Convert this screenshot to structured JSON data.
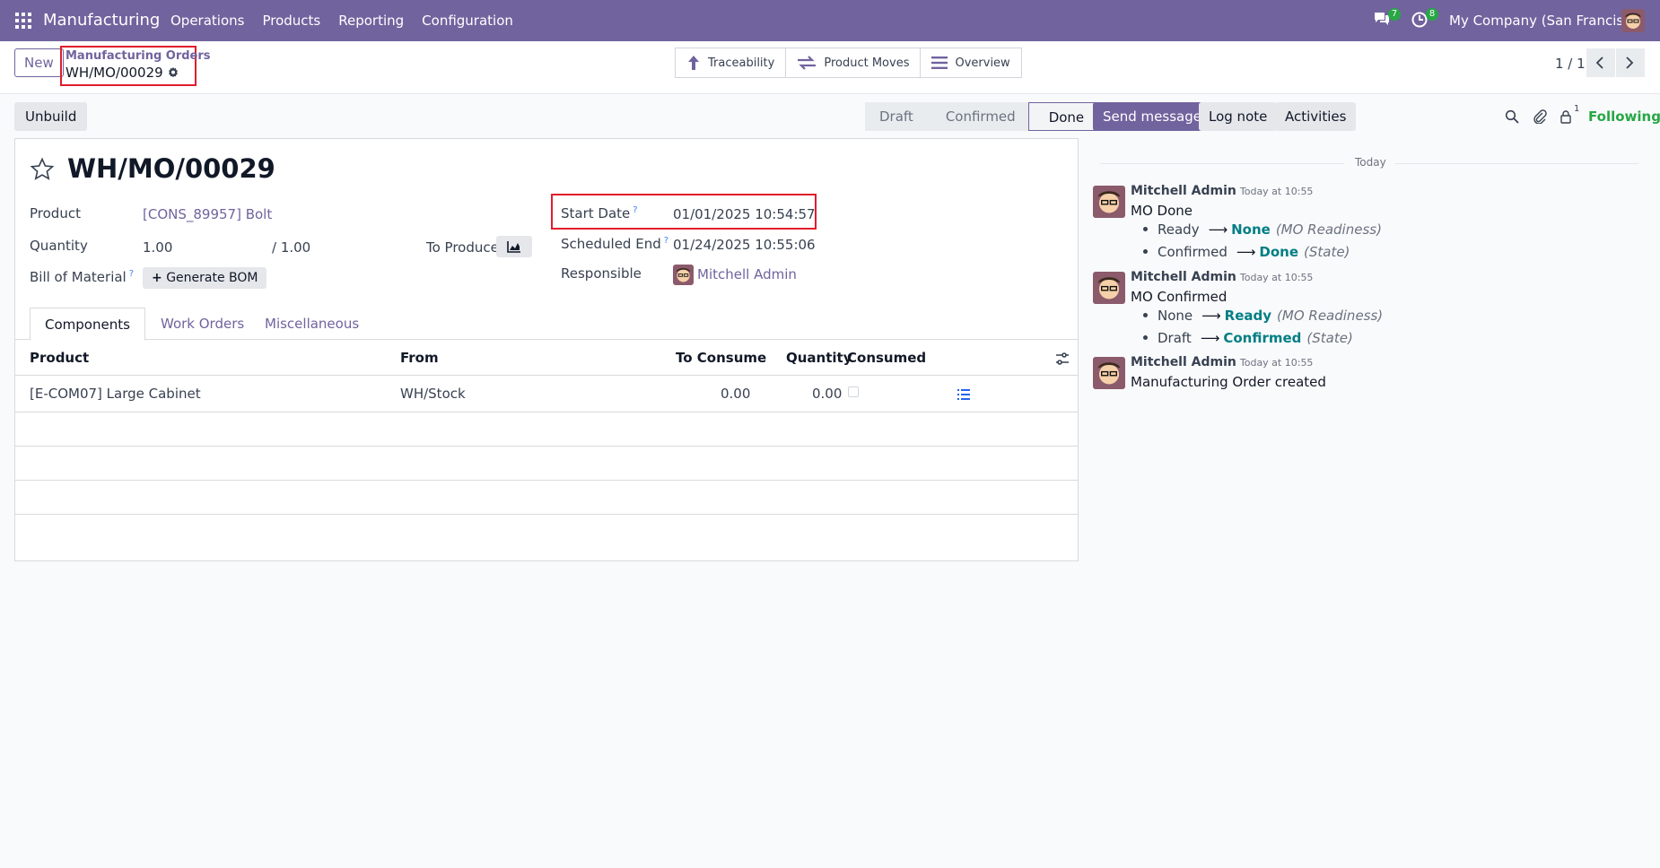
{
  "navbar": {
    "brand": "Manufacturing",
    "menu": [
      "Operations",
      "Products",
      "Reporting",
      "Configuration"
    ],
    "chat_badge": "7",
    "activity_badge": "8",
    "company": "My Company (San Francisco)"
  },
  "control": {
    "new_label": "New",
    "breadcrumb_parent": "Manufacturing Orders",
    "breadcrumb_current": "WH/MO/00029",
    "smart_buttons": [
      "Traceability",
      "Product Moves",
      "Overview"
    ],
    "pager": "1 / 1"
  },
  "actions": {
    "unbuild": "Unbuild"
  },
  "statusbar": {
    "stages": [
      "Draft",
      "Confirmed",
      "Done"
    ],
    "active": "Done"
  },
  "form": {
    "title": "WH/MO/00029",
    "product_label": "Product",
    "product_value": "[CONS_89957] Bolt",
    "quantity_label": "Quantity",
    "quantity_value": "1.00",
    "quantity_total": "/ 1.00",
    "to_produce_label": "To Produce",
    "bom_label": "Bill of Material",
    "bom_help": "?",
    "generate_bom": "Generate BOM",
    "start_date_label": "Start Date",
    "start_date_help": "?",
    "start_date_value": "01/01/2025 10:54:57",
    "scheduled_end_label": "Scheduled End",
    "scheduled_end_help": "?",
    "scheduled_end_value": "01/24/2025 10:55:06",
    "responsible_label": "Responsible",
    "responsible_value": "Mitchell Admin"
  },
  "tabs": [
    "Components",
    "Work Orders",
    "Miscellaneous"
  ],
  "table": {
    "headers": [
      "Product",
      "From",
      "To Consume",
      "Quantity",
      "Consumed"
    ],
    "rows": [
      {
        "product": "[E-COM07] Large Cabinet",
        "from": "WH/Stock",
        "to_consume": "0.00",
        "quantity": "0.00"
      }
    ]
  },
  "chatter": {
    "send_message": "Send message",
    "log_note": "Log note",
    "activities": "Activities",
    "follower_count": "1",
    "following": "Following",
    "day": "Today",
    "messages": [
      {
        "author": "Mitchell Admin",
        "time": "Today at 10:55",
        "body": "MO Done",
        "tracking": [
          {
            "old": "Ready",
            "new": "None",
            "field": "(MO Readiness)"
          },
          {
            "old": "Confirmed",
            "new": "Done",
            "field": "(State)"
          }
        ]
      },
      {
        "author": "Mitchell Admin",
        "time": "Today at 10:55",
        "body": "MO Confirmed",
        "tracking": [
          {
            "old": "None",
            "new": "Ready",
            "field": "(MO Readiness)"
          },
          {
            "old": "Draft",
            "new": "Confirmed",
            "field": "(State)"
          }
        ]
      },
      {
        "author": "Mitchell Admin",
        "time": "Today at 10:55",
        "body": "Manufacturing Order created",
        "tracking": []
      }
    ]
  },
  "colors": {
    "brand": "#71639e",
    "highlight": "#e11d2b",
    "tracking_new": "#017e84",
    "following": "#28a745"
  }
}
